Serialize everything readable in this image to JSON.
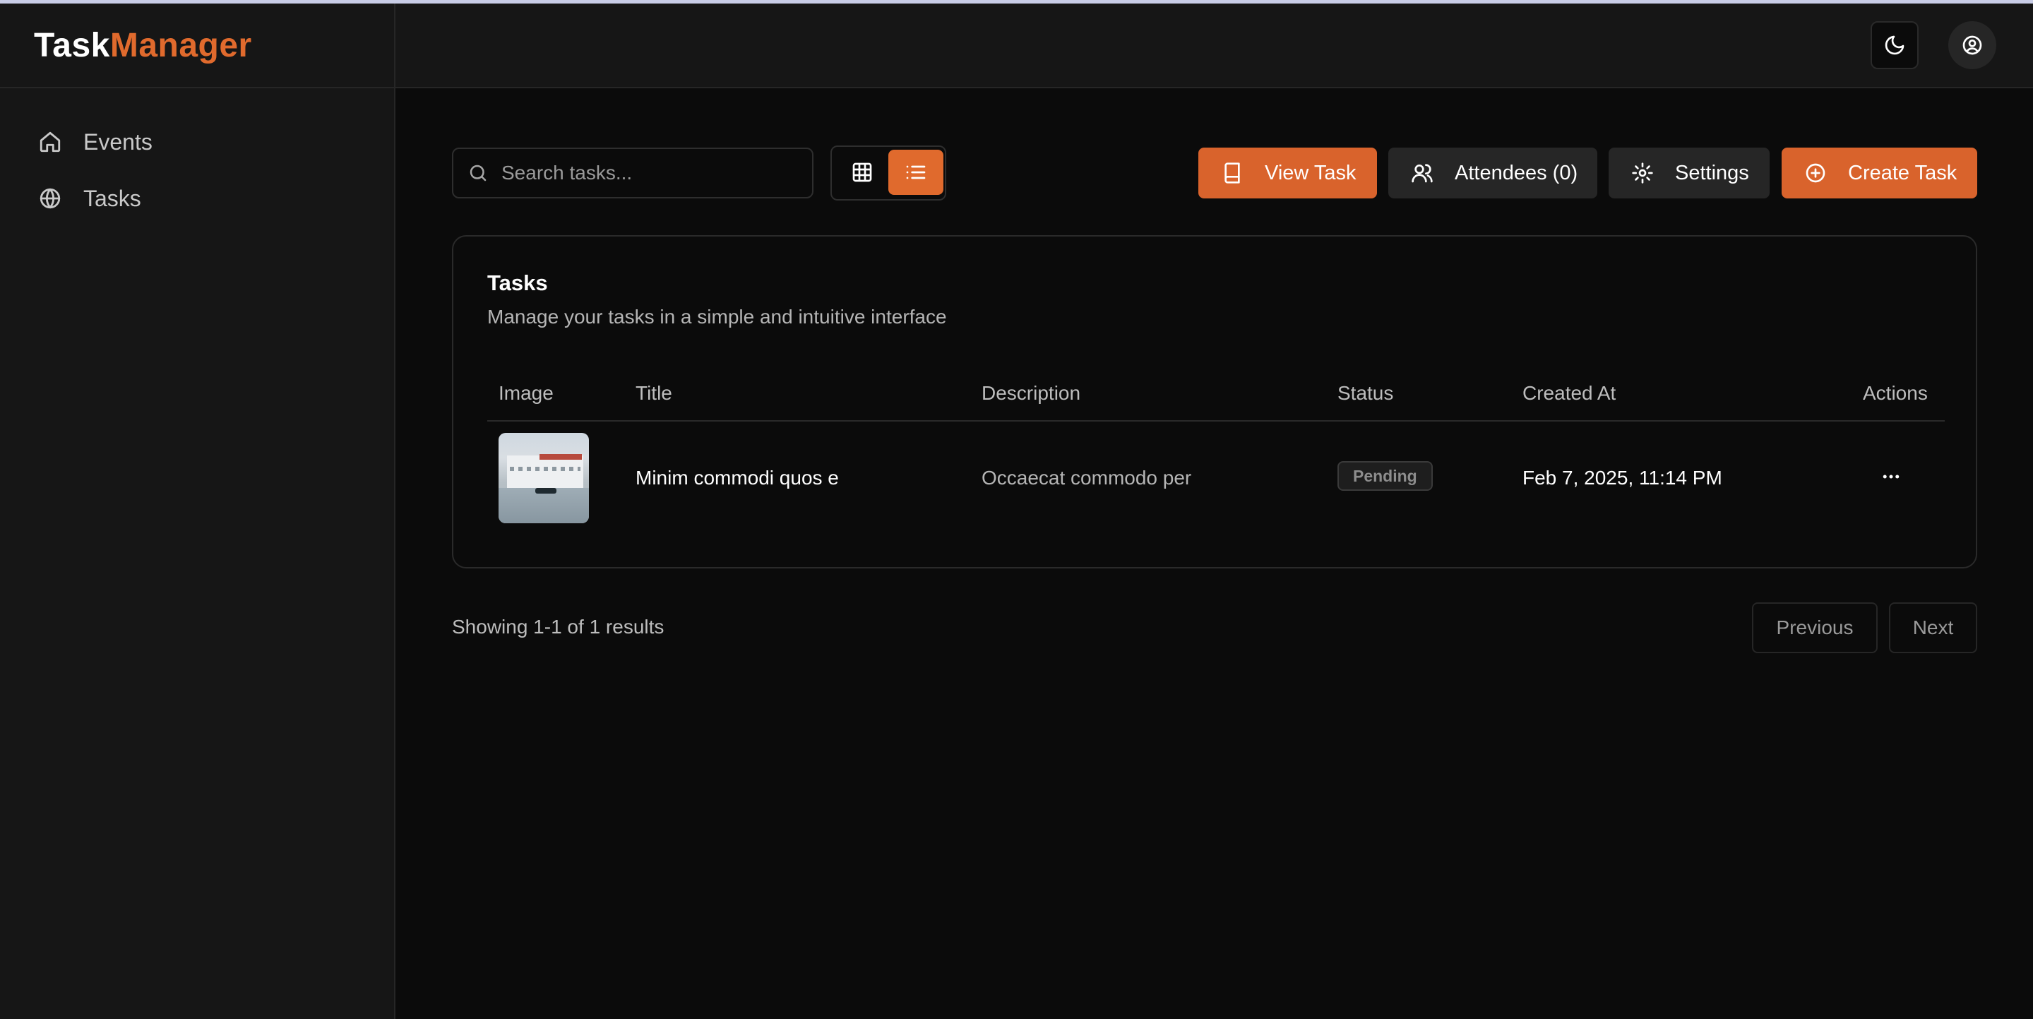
{
  "app": {
    "logo_part1": "Task",
    "logo_part2": "Manager"
  },
  "sidebar": {
    "items": [
      {
        "label": "Events",
        "icon": "home-icon"
      },
      {
        "label": "Tasks",
        "icon": "globe-icon"
      }
    ]
  },
  "header": {
    "theme_icon": "moon-icon",
    "user_icon": "user-circle-icon"
  },
  "toolbar": {
    "search_placeholder": "Search tasks...",
    "view_mode": "list",
    "view_task_label": "View Task",
    "attendees_label": "Attendees (0)",
    "settings_label": "Settings",
    "create_task_label": "Create Task"
  },
  "card": {
    "title": "Tasks",
    "subtitle": "Manage your tasks in a simple and intuitive interface",
    "columns": [
      "Image",
      "Title",
      "Description",
      "Status",
      "Created At",
      "Actions"
    ],
    "rows": [
      {
        "title": "Minim commodi quos e",
        "description": "Occaecat commodo per",
        "status": "Pending",
        "created_at": "Feb 7, 2025, 11:14 PM"
      }
    ]
  },
  "footer": {
    "results_text": "Showing 1-1 of 1 results",
    "previous_label": "Previous",
    "next_label": "Next"
  },
  "colors": {
    "accent": "#e06a2d",
    "background": "#0b0b0b",
    "sidebar": "#161616"
  }
}
